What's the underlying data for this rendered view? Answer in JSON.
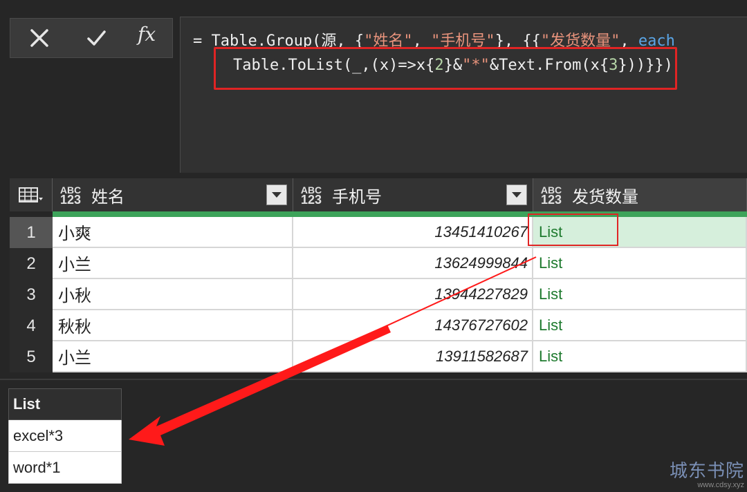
{
  "formula_bar": {
    "line1_parts": [
      "= Table.Group(源, {",
      "\"姓名\"",
      ", ",
      "\"手机号\"",
      "}, {{",
      "\"发货数量\"",
      ", ",
      "each"
    ],
    "line2_parts": [
      "Table.ToList(_,(x)=>x{",
      "2",
      "}&",
      "\"*\"",
      "&Text.From(x{",
      "3",
      "}))}})"
    ]
  },
  "table": {
    "columns": [
      {
        "type_top": "ABC",
        "type_bottom": "123",
        "label": "姓名"
      },
      {
        "type_top": "ABC",
        "type_bottom": "123",
        "label": "手机号"
      },
      {
        "type_top": "ABC",
        "type_bottom": "123",
        "label": "发货数量"
      }
    ],
    "rows": [
      {
        "num": "1",
        "name": "小爽",
        "phone": "13451410267",
        "qty": "List"
      },
      {
        "num": "2",
        "name": "小兰",
        "phone": "13624999844",
        "qty": "List"
      },
      {
        "num": "3",
        "name": "小秋",
        "phone": "13944227829",
        "qty": "List"
      },
      {
        "num": "4",
        "name": "秋秋",
        "phone": "14376727602",
        "qty": "List"
      },
      {
        "num": "5",
        "name": "小兰",
        "phone": "13911582687",
        "qty": "List"
      }
    ]
  },
  "result_list": {
    "header": "List",
    "items": [
      "excel*3",
      "word*1"
    ]
  },
  "watermark": {
    "line1": "城东书院",
    "line2": "www.cdsy.xyz"
  },
  "colors": {
    "accent_green": "#3da35a",
    "annotation_red": "#e02424",
    "list_text": "#1e7a2e"
  }
}
